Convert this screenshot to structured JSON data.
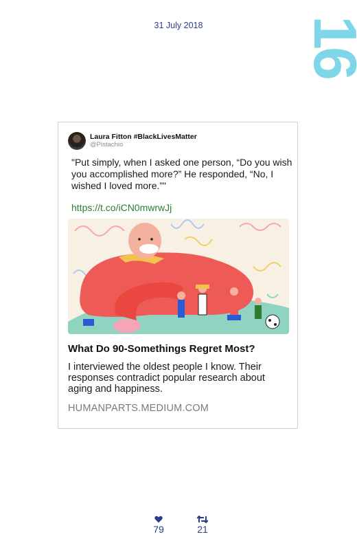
{
  "date": "31 July 2018",
  "page_number": "16",
  "tweet": {
    "author_name": "Laura Fitton #BlackLivesMatter",
    "author_handle": "@Pistachio",
    "text": "\"Put simply, when I asked one person, “Do you wish you accomplished more?” He responded, “No, I wished I loved more.”\"",
    "link": "https://t.co/iCN0mwrwJj",
    "preview": {
      "title": "What Do 90-Somethings Regret Most?",
      "description": "I interviewed the oldest people I know. Their responses contradict popular research about aging and happiness.",
      "domain": "HUMANPARTS.MEDIUM.COM"
    }
  },
  "stats": {
    "likes": "79",
    "retweets": "21"
  },
  "icons": {
    "like": "heart-icon",
    "retweet": "retweet-icon"
  },
  "colors": {
    "accent_navy": "#2e3a8c",
    "page_number_cyan": "#7ed6e8",
    "link_green": "#2e7d32"
  }
}
